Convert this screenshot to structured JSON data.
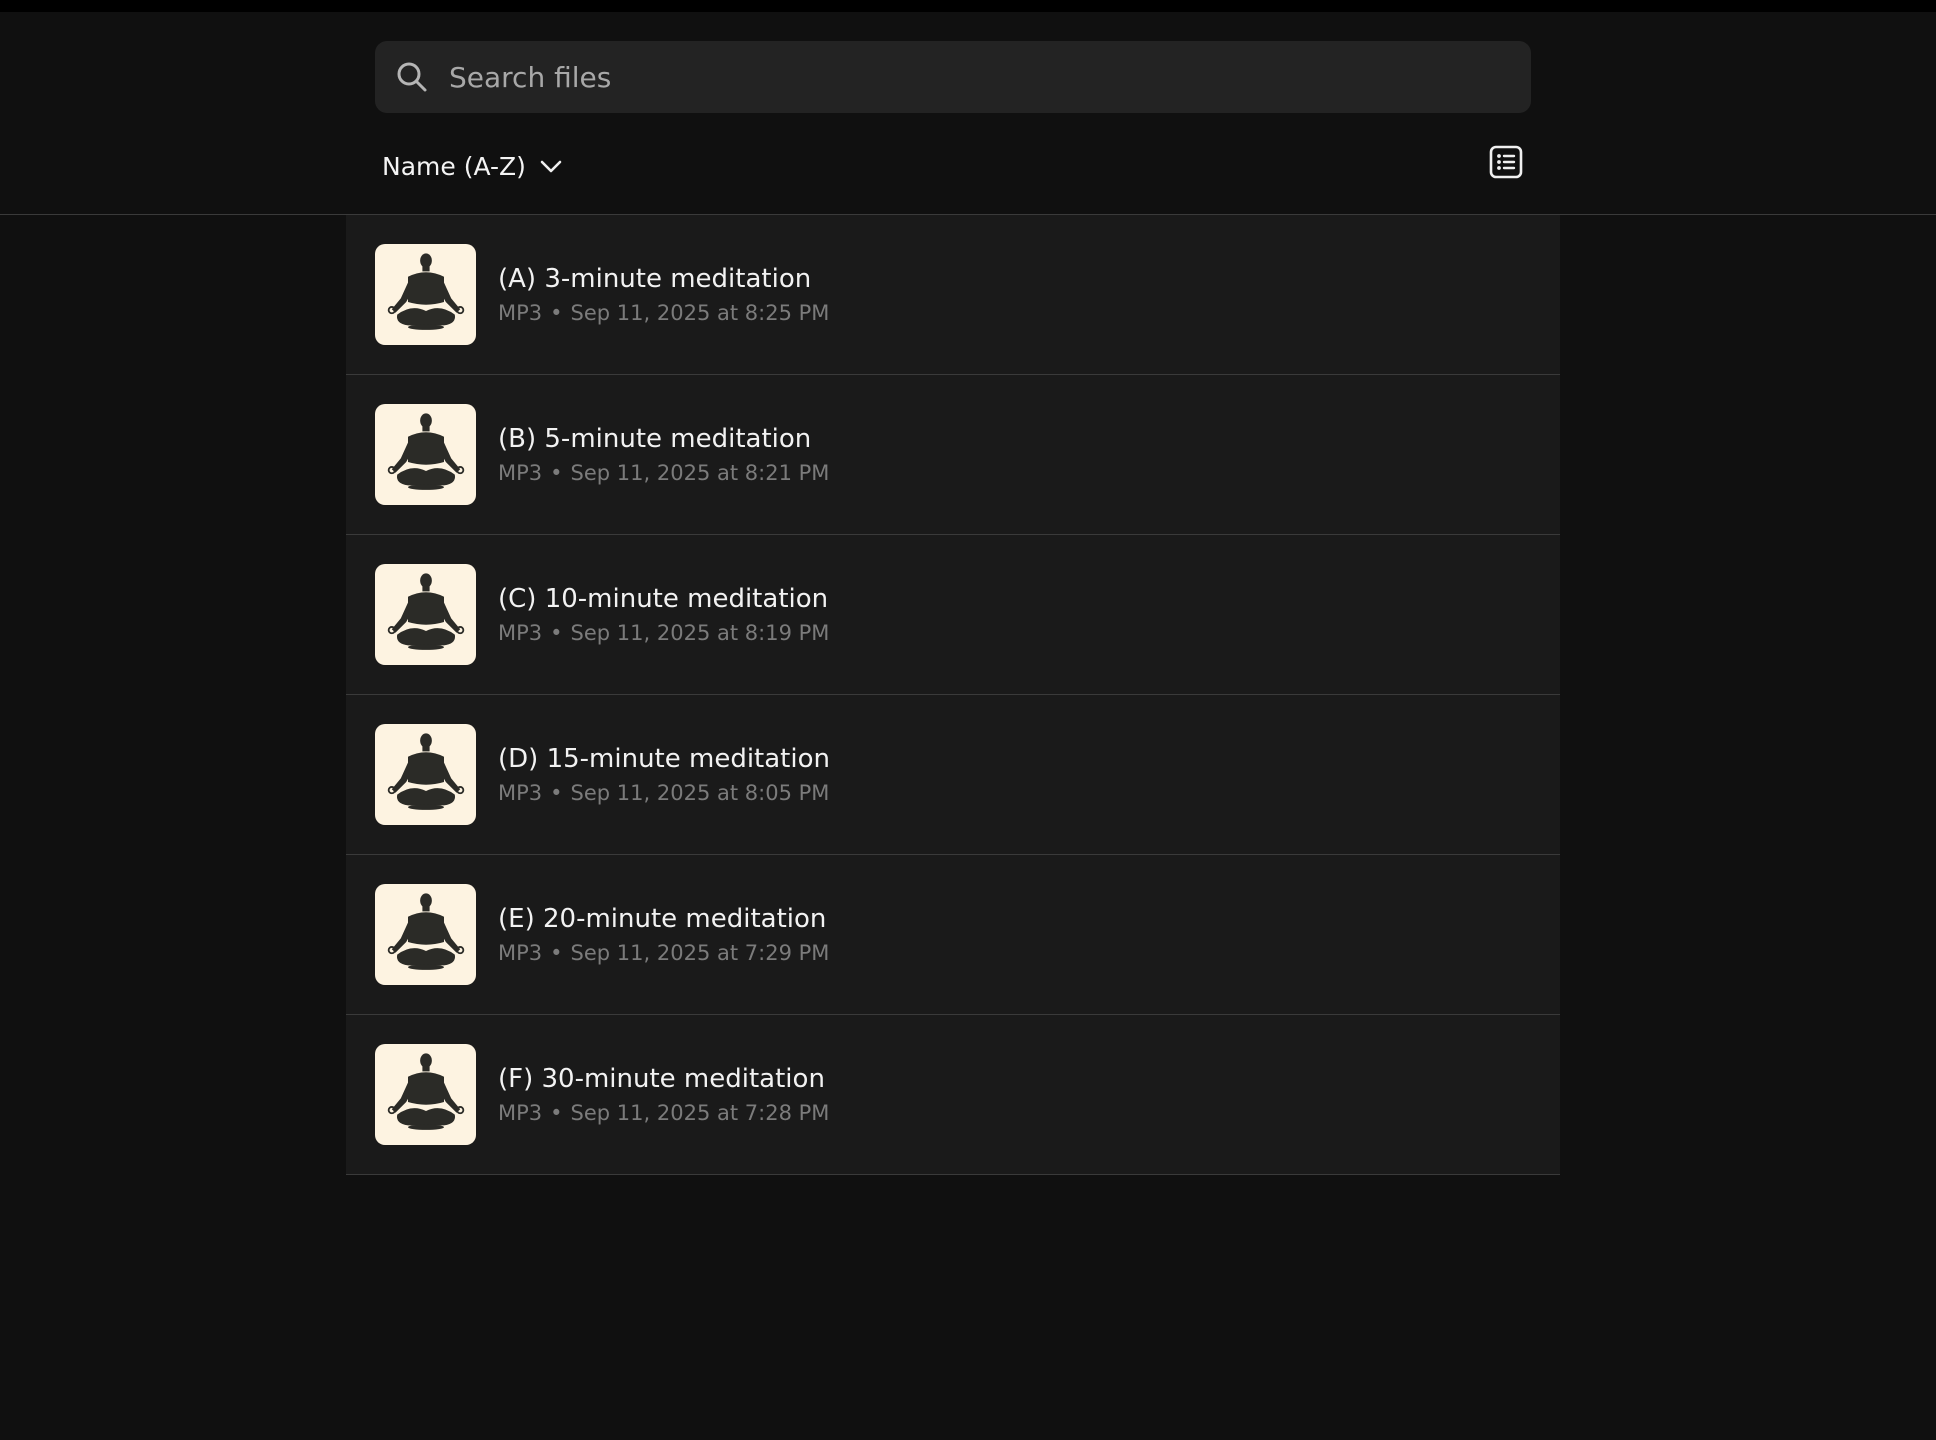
{
  "search": {
    "placeholder": "Search files",
    "value": ""
  },
  "toolbar": {
    "sort_label": "Name (A-Z)",
    "sort_icon": "chevron-down-icon",
    "view_icon": "list-view-icon"
  },
  "files": [
    {
      "title": "(A) 3-minute meditation",
      "type": "MP3",
      "separator": "•",
      "date": "Sep 11, 2025 at 8:25 PM",
      "thumb_icon": "meditation-icon"
    },
    {
      "title": "(B) 5-minute meditation",
      "type": "MP3",
      "separator": "•",
      "date": "Sep 11, 2025 at 8:21 PM",
      "thumb_icon": "meditation-icon"
    },
    {
      "title": "(C) 10-minute meditation",
      "type": "MP3",
      "separator": "•",
      "date": "Sep 11, 2025 at 8:19 PM",
      "thumb_icon": "meditation-icon"
    },
    {
      "title": "(D) 15-minute meditation",
      "type": "MP3",
      "separator": "•",
      "date": "Sep 11, 2025 at 8:05 PM",
      "thumb_icon": "meditation-icon"
    },
    {
      "title": "(E) 20-minute meditation",
      "type": "MP3",
      "separator": "•",
      "date": "Sep 11, 2025 at 7:29 PM",
      "thumb_icon": "meditation-icon"
    },
    {
      "title": "(F) 30-minute meditation",
      "type": "MP3",
      "separator": "•",
      "date": "Sep 11, 2025 at 7:28 PM",
      "thumb_icon": "meditation-icon"
    }
  ],
  "colors": {
    "background": "#101010",
    "row_background": "#1a1a1a",
    "search_background": "#232323",
    "thumbnail_background": "#fdf3e1",
    "silhouette": "#2b2b27"
  }
}
